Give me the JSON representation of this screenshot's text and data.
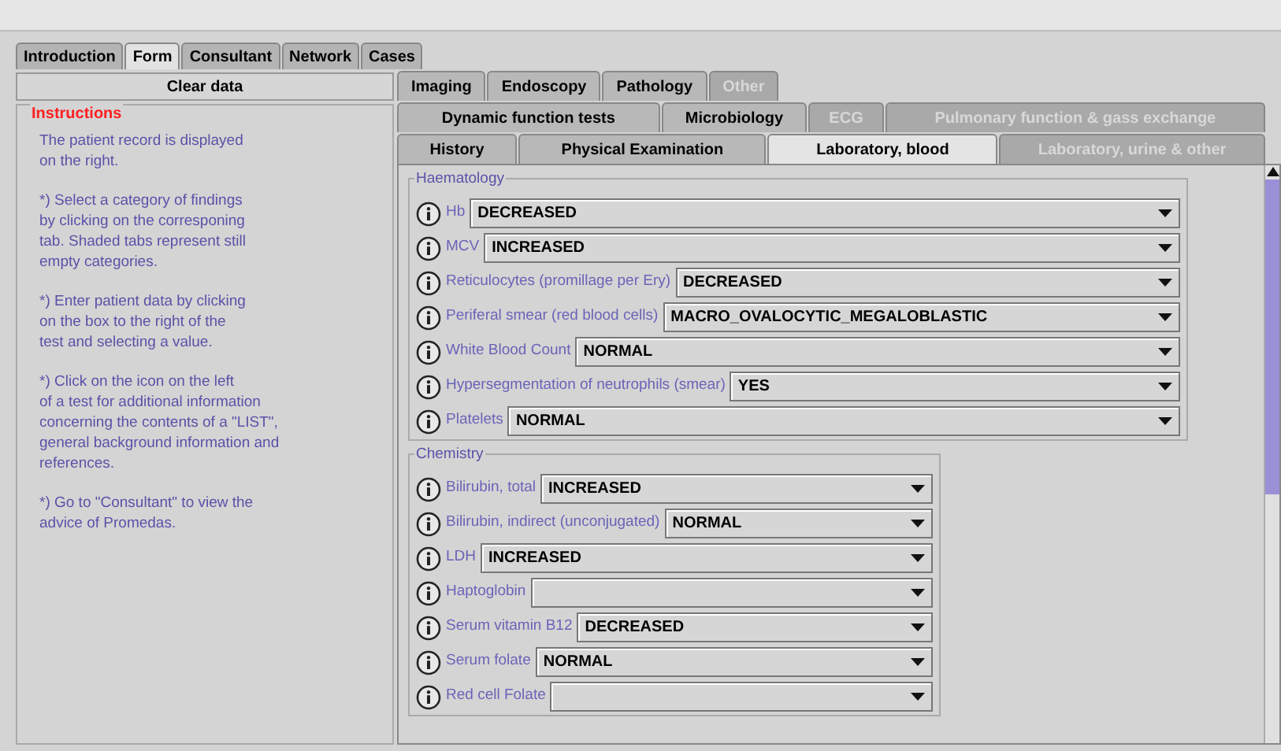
{
  "main_tabs": [
    {
      "label": "Introduction",
      "selected": false
    },
    {
      "label": "Form",
      "selected": true
    },
    {
      "label": "Consultant",
      "selected": false
    },
    {
      "label": "Network",
      "selected": false
    },
    {
      "label": "Cases",
      "selected": false
    }
  ],
  "clear_button": "Clear data",
  "instructions": {
    "title": "Instructions",
    "paragraphs": [
      "The patient record is displayed\non the right.",
      "*) Select a category of findings\nby clicking on the corresponing\ntab. Shaded tabs represent still\nempty categories.",
      "*) Enter patient data by clicking\non the box to the right of the\ntest and selecting a value.",
      "*) Click on the icon on the left\nof a test for additional information\nconcerning the contents of a \"LIST\",\ngeneral background information and\nreferences.",
      "*) Go to \"Consultant\" to view the\nadvice of Promedas."
    ]
  },
  "category_tab_rows": [
    [
      {
        "label": "Imaging",
        "selected": false,
        "empty": false
      },
      {
        "label": "Endoscopy",
        "selected": false,
        "empty": false
      },
      {
        "label": "Pathology",
        "selected": false,
        "empty": false
      },
      {
        "label": "Other",
        "selected": false,
        "empty": true
      }
    ],
    [
      {
        "label": "Dynamic function tests",
        "selected": false,
        "empty": false
      },
      {
        "label": "Microbiology",
        "selected": false,
        "empty": false
      },
      {
        "label": "ECG",
        "selected": false,
        "empty": true
      },
      {
        "label": "Pulmonary function & gass exchange",
        "selected": false,
        "empty": true
      }
    ],
    [
      {
        "label": "History",
        "selected": false,
        "empty": false
      },
      {
        "label": "Physical Examination",
        "selected": false,
        "empty": false
      },
      {
        "label": "Laboratory, blood",
        "selected": true,
        "empty": false
      },
      {
        "label": "Laboratory, urine & other",
        "selected": false,
        "empty": true
      }
    ]
  ],
  "groups": [
    {
      "title": "Haematology",
      "wide": true,
      "fields": [
        {
          "label": "Hb",
          "value": "DECREASED"
        },
        {
          "label": "MCV",
          "value": "INCREASED"
        },
        {
          "label": "Reticulocytes (promillage per Ery)",
          "value": "DECREASED"
        },
        {
          "label": "Periferal smear (red blood cells)",
          "value": "MACRO_OVALOCYTIC_MEGALOBLASTIC"
        },
        {
          "label": "White Blood Count",
          "value": "NORMAL"
        },
        {
          "label": "Hypersegmentation of neutrophils (smear)",
          "value": "YES"
        },
        {
          "label": "Platelets",
          "value": "NORMAL"
        }
      ]
    },
    {
      "title": "Chemistry",
      "wide": false,
      "fields": [
        {
          "label": "Bilirubin, total",
          "value": "INCREASED"
        },
        {
          "label": "Bilirubin, indirect (unconjugated)",
          "value": "NORMAL"
        },
        {
          "label": "LDH",
          "value": "INCREASED"
        },
        {
          "label": "Haptoglobin"
        },
        {
          "label": "Serum vitamin B12",
          "value": "DECREASED"
        },
        {
          "label": "Serum folate",
          "value": "NORMAL"
        },
        {
          "label": "Red cell Folate"
        }
      ]
    }
  ]
}
